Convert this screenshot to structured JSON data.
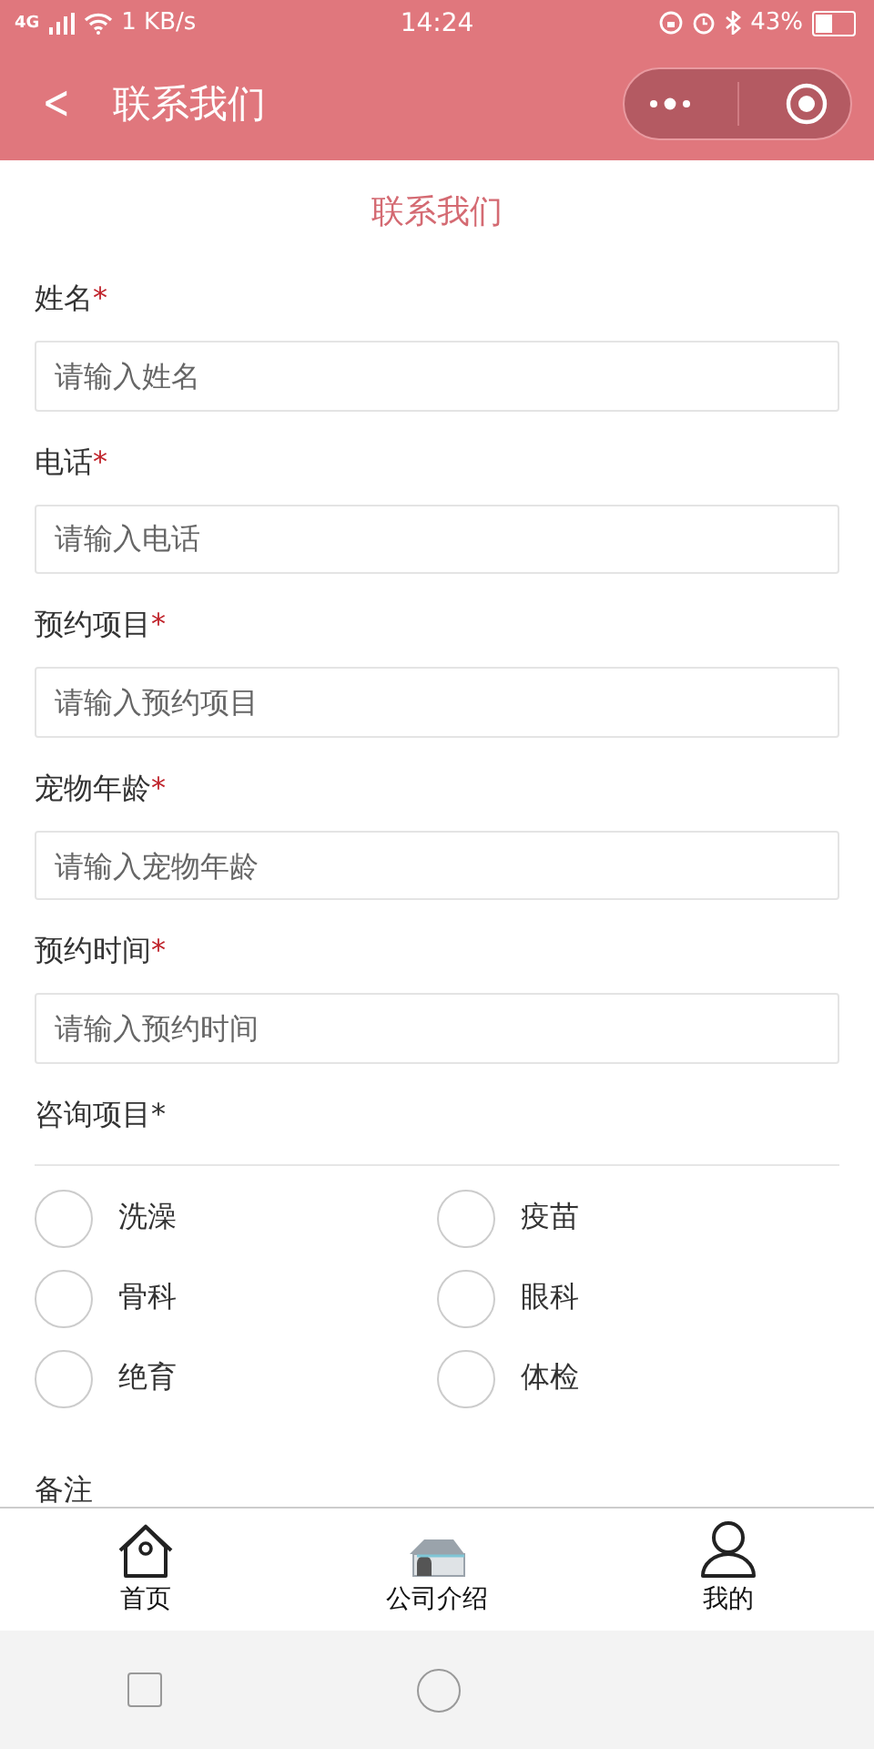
{
  "status_bar": {
    "signal": "4G",
    "speed": "1 KB/s",
    "time": "14:24",
    "battery": "43%"
  },
  "header": {
    "back": "<",
    "title": "联系我们"
  },
  "form": {
    "heading": "联系我们",
    "fields": [
      {
        "label": "姓名",
        "mark": "*",
        "mark_red": true,
        "placeholder": "请输入姓名"
      },
      {
        "label": "电话",
        "mark": "*",
        "mark_red": true,
        "placeholder": "请输入电话"
      },
      {
        "label": "预约项目",
        "mark": "*",
        "mark_red": true,
        "placeholder": "请输入预约项目"
      },
      {
        "label": "宠物年龄",
        "mark": "*",
        "mark_red": true,
        "placeholder": "请输入宠物年龄"
      },
      {
        "label": "预约时间",
        "mark": "*",
        "mark_red": true,
        "placeholder": "请输入预约时间"
      }
    ],
    "options_label": {
      "label": "咨询项目",
      "mark": "*",
      "mark_red": false
    },
    "options": [
      {
        "label": "洗澡",
        "checked": false
      },
      {
        "label": "疫苗",
        "checked": false
      },
      {
        "label": "骨科",
        "checked": false
      },
      {
        "label": "眼科",
        "checked": false
      },
      {
        "label": "绝育",
        "checked": false
      },
      {
        "label": "体检",
        "checked": false
      }
    ],
    "notes_label": "备注"
  },
  "tab_bar": [
    {
      "label": "首页"
    },
    {
      "label": "公司介绍"
    },
    {
      "label": "我的"
    }
  ]
}
